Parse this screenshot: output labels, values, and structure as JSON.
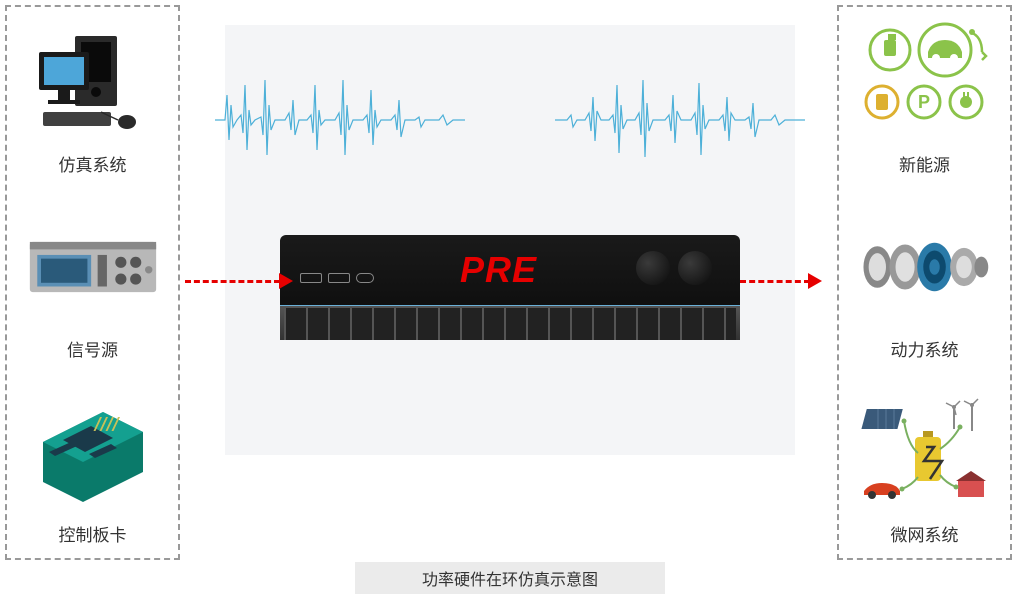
{
  "title": "功率硬件在环仿真示意图",
  "left_items": [
    {
      "label": "仿真系统",
      "icon": "computer"
    },
    {
      "label": "信号源",
      "icon": "signal-gen"
    },
    {
      "label": "控制板卡",
      "icon": "circuit-board"
    }
  ],
  "right_items": [
    {
      "label": "新能源",
      "icon": "new-energy"
    },
    {
      "label": "动力系统",
      "icon": "power-system"
    },
    {
      "label": "微网系统",
      "icon": "microgrid"
    }
  ],
  "device_logo": "PRE",
  "caption": "功率硬件在环仿真示意图"
}
